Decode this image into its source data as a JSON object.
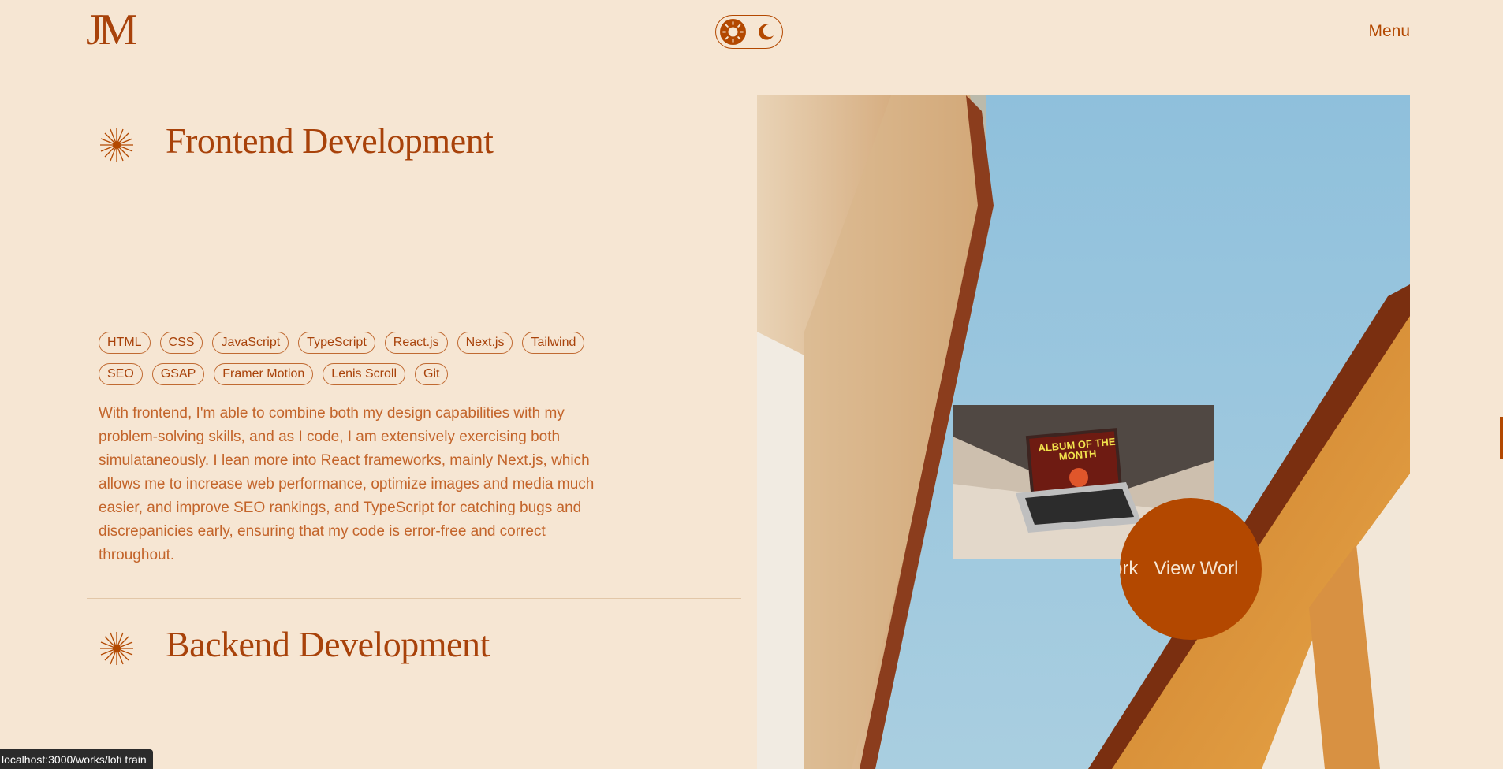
{
  "header": {
    "logo": "JM",
    "menu_label": "Menu"
  },
  "theme_toggle": {
    "light_icon": "sun-icon",
    "dark_icon": "moon-icon",
    "active": "light"
  },
  "sections": [
    {
      "title": "Frontend Development",
      "icon": "starburst-icon",
      "tags": [
        "HTML",
        "CSS",
        "JavaScript",
        "TypeScript",
        "React.js",
        "Next.js",
        "Tailwind",
        "SEO",
        "GSAP",
        "Framer Motion",
        "Lenis Scroll",
        "Git"
      ],
      "description": "With frontend, I'm able to combine both my design capabilities with my problem-solving skills, and as I code, I am extensively exercising both simulataneously. I lean more into React frameworks, mainly Next.js, which allows me to increase web performance, optimize images and media much easier, and improve SEO rankings, and TypeScript for catching bugs and discrepanicies early, ensuring that my code is error-free and correct throughout."
    },
    {
      "title": "Backend Development",
      "icon": "starburst-icon"
    }
  ],
  "work_preview": {
    "thumbnail_text": "ALBUM OF THE MONTH",
    "cta_label": "ork   View Worl"
  },
  "status_bar": {
    "url": "localhost:3000/works/lofi train"
  },
  "colors": {
    "background": "#f6e6d3",
    "accent": "#b34800",
    "text": "#c3642a"
  }
}
